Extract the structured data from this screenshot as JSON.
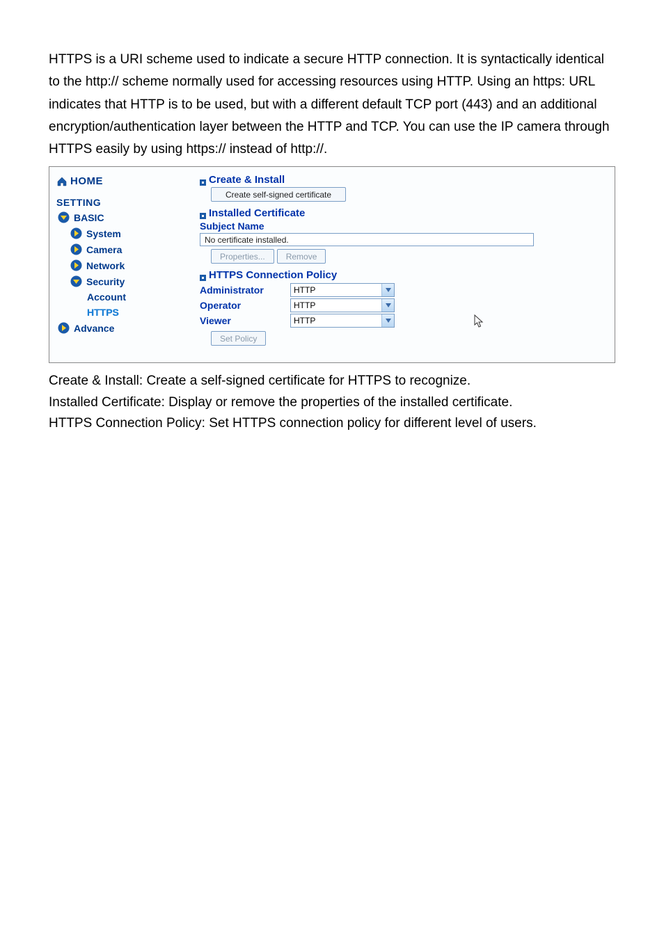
{
  "intro": {
    "p1": "HTTPS is a URI scheme used to indicate a secure HTTP connection. It is syntactically identical to the http:// scheme normally used for accessing resources using HTTP. Using an https: URL indicates that HTTP is to be used, but with a different default TCP port (443) and an additional encryption/authentication layer between the HTTP and TCP. You can use the IP camera through HTTPS easily by using https:// instead of http://."
  },
  "sidebar": {
    "home": "HOME",
    "setting": "SETTING",
    "basic": "BASIC",
    "system": "System",
    "camera": "Camera",
    "network": "Network",
    "security": "Security",
    "account": "Account",
    "https": "HTTPS",
    "advance": "Advance"
  },
  "content": {
    "create_install": {
      "title": "Create & Install",
      "button": "Create self-signed certificate"
    },
    "installed_cert": {
      "title": "Installed Certificate",
      "subject": "Subject Name",
      "value": "No certificate installed.",
      "properties": "Properties...",
      "remove": "Remove"
    },
    "policy": {
      "title": "HTTPS Connection Policy",
      "admin_label": "Administrator",
      "admin_value": "HTTP",
      "operator_label": "Operator",
      "operator_value": "HTTP",
      "viewer_label": "Viewer",
      "viewer_value": "HTTP",
      "set_policy": "Set Policy"
    }
  },
  "notes": {
    "n1": "Create & Install: Create a self-signed certificate for HTTPS to recognize.",
    "n2": "Installed Certificate: Display or remove the properties of the installed certificate.",
    "n3": "HTTPS Connection Policy: Set HTTPS connection policy for different level of users."
  }
}
